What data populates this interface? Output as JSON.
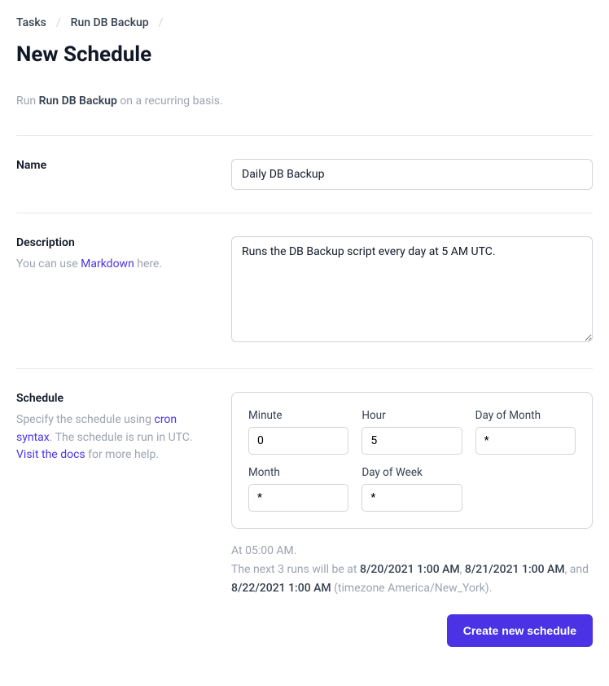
{
  "breadcrumb": {
    "tasks": "Tasks",
    "task_name": "Run DB Backup",
    "sep": "/"
  },
  "page_title": "New Schedule",
  "intro": {
    "prefix": "Run ",
    "task_name": "Run DB Backup",
    "suffix": " on a recurring basis."
  },
  "name_section": {
    "label": "Name",
    "value": "Daily DB Backup"
  },
  "description_section": {
    "label": "Description",
    "help_prefix": "You can use ",
    "help_link": "Markdown",
    "help_suffix": " here.",
    "value": "Runs the DB Backup script every day at 5 AM UTC."
  },
  "schedule_section": {
    "label": "Schedule",
    "help_prefix": "Specify the schedule using ",
    "help_link1": "cron syntax",
    "help_mid": ". The schedule is run in UTC.",
    "help_link2": "Visit the docs",
    "help_suffix": " for more help.",
    "fields": {
      "minute": {
        "label": "Minute",
        "value": "0"
      },
      "hour": {
        "label": "Hour",
        "value": "5"
      },
      "day_of_month": {
        "label": "Day of Month",
        "value": "*"
      },
      "month": {
        "label": "Month",
        "value": "*"
      },
      "day_of_week": {
        "label": "Day of Week",
        "value": "*"
      }
    },
    "summary": {
      "at": "At 05:00 AM.",
      "next_prefix": "The next 3 runs will be at ",
      "run1": "8/20/2021 1:00 AM",
      "sep1": ", ",
      "run2": "8/21/2021 1:00 AM",
      "sep2": ", and ",
      "run3": "8/22/2021 1:00 AM",
      "tz": " (timezone America/New_York)."
    }
  },
  "actions": {
    "create": "Create new schedule"
  }
}
